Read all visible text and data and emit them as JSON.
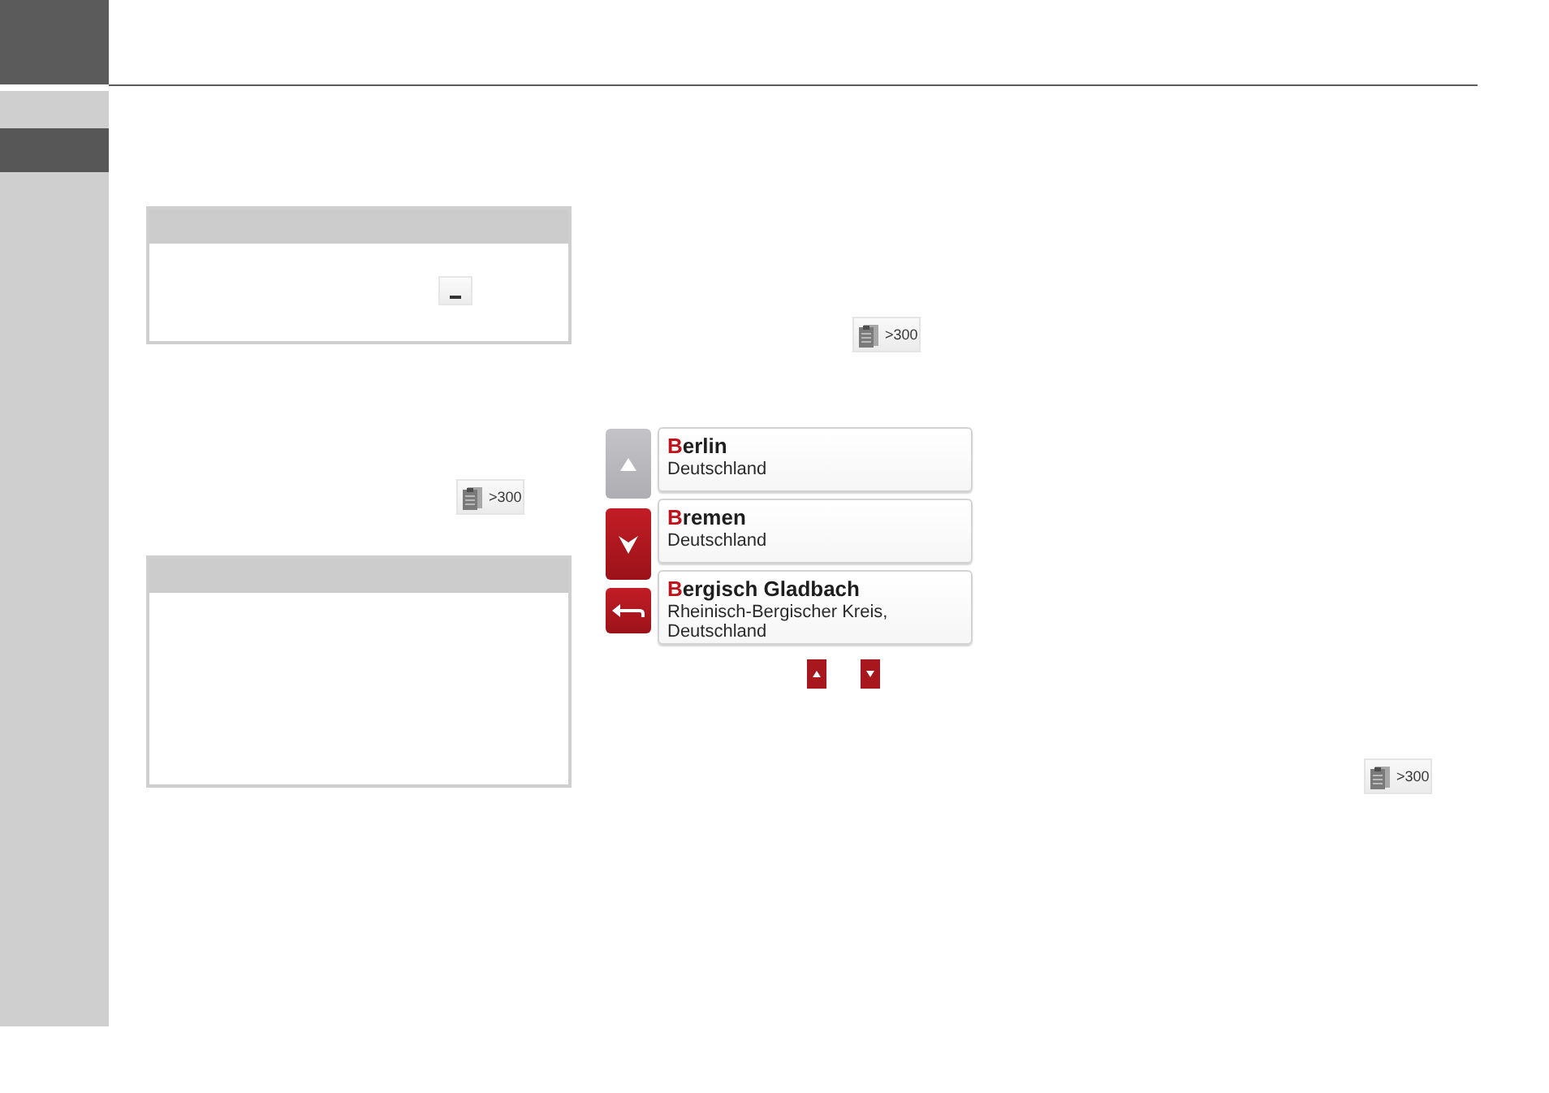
{
  "sidebar": {
    "tabs": [
      {
        "selected": true
      }
    ]
  },
  "left_column": [
    {
      "kind": "note",
      "has_button": true
    },
    {
      "kind": "count_button",
      "label": ">300"
    },
    {
      "kind": "note",
      "has_button": false
    }
  ],
  "right_column": [
    {
      "kind": "count_button",
      "label": ">300"
    },
    {
      "kind": "result_list",
      "buttons": [
        {
          "kind": "up",
          "disabled": true
        },
        {
          "kind": "down",
          "disabled": false
        },
        {
          "kind": "back",
          "disabled": false
        }
      ],
      "rows": [
        {
          "name": [
            {
              "text": "B",
              "highlight": true
            },
            {
              "text": "erlin",
              "highlight": false
            }
          ],
          "region": "Deutschland"
        },
        {
          "name": [
            {
              "text": "B",
              "highlight": true
            },
            {
              "text": "remen",
              "highlight": false
            }
          ],
          "region": "Deutschland"
        },
        {
          "name": [
            {
              "text": "B",
              "highlight": true
            },
            {
              "text": "ergisch Gladbach",
              "highlight": false
            }
          ],
          "region": "Rheinisch-Bergischer Kreis, Deutschland"
        }
      ]
    },
    {
      "kind": "arrow_icons",
      "icons": [
        {
          "kind": "up"
        },
        {
          "kind": "down"
        }
      ]
    },
    {
      "kind": "count_button",
      "label": ">300"
    }
  ]
}
